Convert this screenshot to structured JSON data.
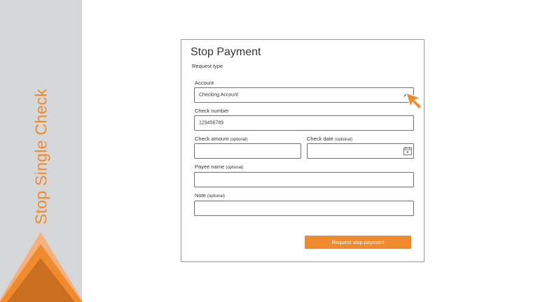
{
  "sidebar": {
    "title": "Stop Single Check"
  },
  "form": {
    "title": "Stop Payment",
    "subtitle": "Request type",
    "account": {
      "label": "Account",
      "value": "Checking Account"
    },
    "check_number": {
      "label": "Check number",
      "value": "123456789"
    },
    "check_amount": {
      "label": "Check amount",
      "optional": "(optional)",
      "value": ""
    },
    "check_date": {
      "label": "Check date",
      "optional": "(optional)",
      "value": ""
    },
    "payee_name": {
      "label": "Payee name",
      "optional": "(optional)",
      "value": ""
    },
    "note": {
      "label": "Note",
      "optional": "(optional)",
      "value": ""
    },
    "submit_label": "Request stop payment"
  },
  "colors": {
    "accent": "#ef8a2e",
    "sidebar_bg": "#d6d7d9",
    "border": "#6f6f6f"
  },
  "icons": {
    "dropdown": "chevron-up-icon",
    "date": "calendar-icon",
    "pointer": "cursor-arrow-icon"
  }
}
